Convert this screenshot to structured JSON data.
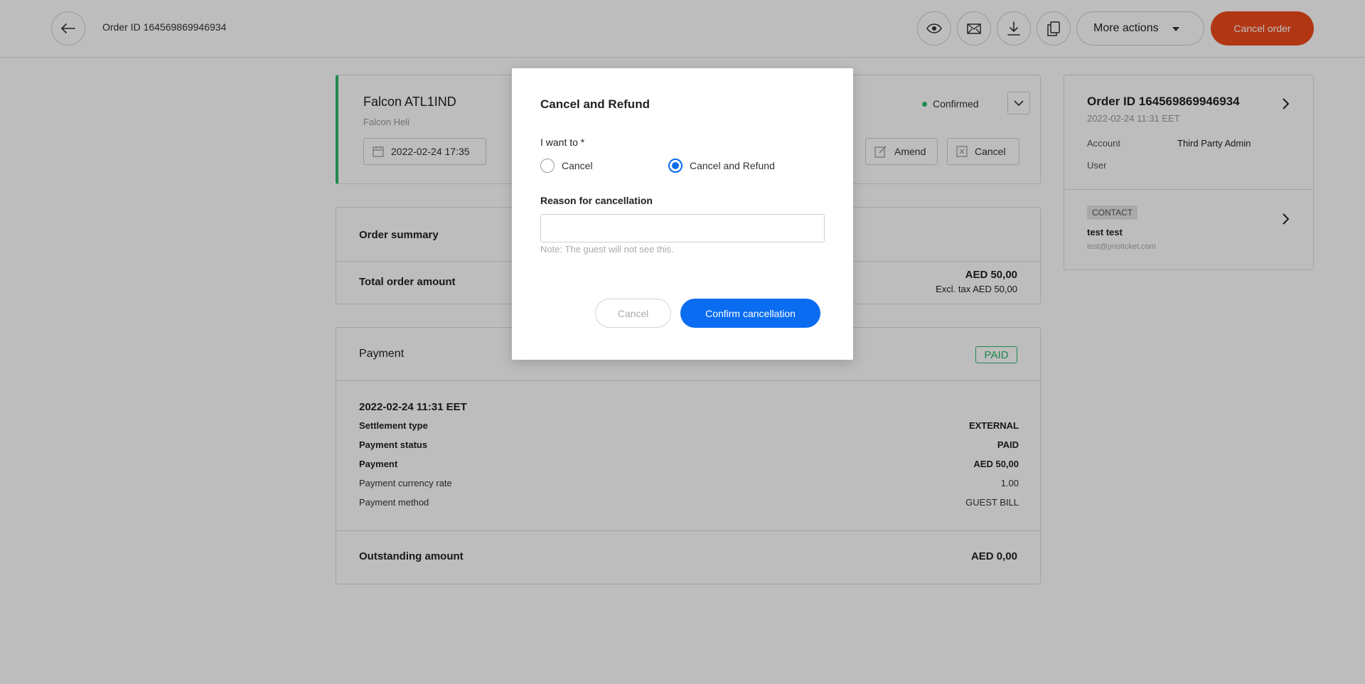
{
  "header": {
    "back_icon": "arrow-left-icon",
    "order_id_label": "Order ID 164569869946934",
    "icon_buttons": [
      "eye-icon",
      "mail-icon",
      "download-icon",
      "copy-icon"
    ],
    "more_actions_label": "More actions",
    "cancel_order_label": "Cancel order",
    "cancel_order_color": "#ef4a1c"
  },
  "booking": {
    "title": "Falcon ATL1IND",
    "subtitle": "Falcon Heli",
    "datetime": "2022-02-24 17:35",
    "status": "Confirmed",
    "status_color": "#2ab86a",
    "amend_label": "Amend",
    "cancel_label": "Cancel"
  },
  "order_summary": {
    "title": "Order summary",
    "total_label": "Total order amount",
    "total_value": "AED 50,00",
    "total_excl_tax": "Excl. tax AED 50,00"
  },
  "payment": {
    "title": "Payment",
    "badge": "PAID",
    "date": "2022-02-24 11:31 EET",
    "rows": [
      {
        "label": "Settlement type",
        "value": "EXTERNAL",
        "bold": true
      },
      {
        "label": "Payment status",
        "value": "PAID",
        "bold": true
      },
      {
        "label": "Payment",
        "value": "AED 50,00",
        "bold": true
      },
      {
        "label": "Payment currency rate",
        "value": "1.00",
        "bold": false
      },
      {
        "label": "Payment method",
        "value": "GUEST BILL",
        "bold": false
      }
    ],
    "outstanding_label": "Outstanding amount",
    "outstanding_value": "AED 0,00"
  },
  "side": {
    "order_id": "Order ID 164569869946934",
    "date": "2022-02-24 11:31 EET",
    "account_label": "Account",
    "account_value": "Third Party Admin",
    "user_label": "User",
    "contact_badge": "CONTACT",
    "contact_name": "test test",
    "contact_email": "test@prioticket.com"
  },
  "modal": {
    "title": "Cancel and Refund",
    "want_label": "I want to *",
    "options": [
      {
        "label": "Cancel",
        "selected": false
      },
      {
        "label": "Cancel and Refund",
        "selected": true
      }
    ],
    "reason_label": "Reason for cancellation",
    "reason_value": "",
    "reason_note": "Note: The guest will not see this.",
    "cancel_label": "Cancel",
    "confirm_label": "Confirm cancellation",
    "accent_color": "#0a6cf1"
  }
}
